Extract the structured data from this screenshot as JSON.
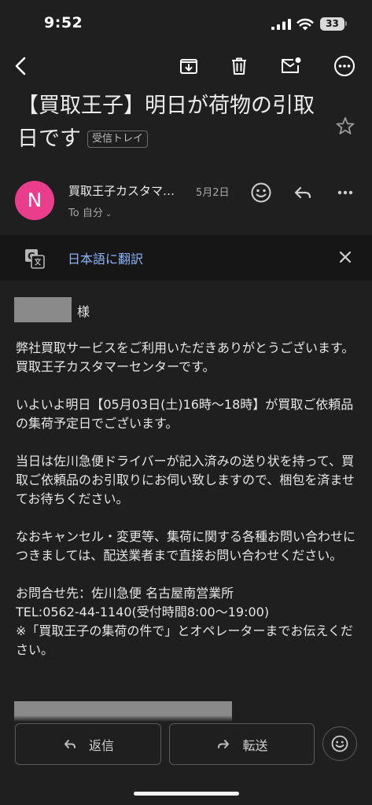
{
  "status_bar": {
    "time": "9:52",
    "battery": "33"
  },
  "email": {
    "subject": "【買取王子】明日が荷物の引取日です",
    "label": "受信トレイ",
    "sender": {
      "avatar_letter": "N",
      "avatar_color": "#ea3d8c",
      "name": "買取王子カスタマ…",
      "date": "5月2日",
      "to": "To 自分"
    },
    "translate": {
      "label": "日本語に翻訳"
    },
    "body": {
      "salutation": "様",
      "p1": "弊社買取サービスをご利用いただきありがとうございます。買取王子カスタマーセンターです。",
      "p2": "いよいよ明日【05月03日(土)16時〜18時】が買取ご依頼品の集荷予定日でございます。",
      "p3": "当日は佐川急便ドライバーが記入済みの送り状を持って、買取ご依頼品のお引取りにお伺い致しますので、梱包を済ませてお待ちください。",
      "p4": "なおキャンセル・変更等、集荷に関する各種お問い合わせにつきましては、配送業者まで直接お問い合わせください。",
      "contact_1": "お問合せ先：佐川急便 名古屋南営業所",
      "contact_2": "TEL:0562-44-1140(受付時間8:00〜19:00)",
      "contact_3": "※「買取王子の集荷の件で」とオペレーターまでお伝えください。"
    }
  },
  "actions": {
    "reply": "返信",
    "forward": "転送"
  },
  "icons": {
    "back": "back-arrow-icon",
    "archive": "archive-icon",
    "trash": "trash-icon",
    "mark_unread": "mark-unread-icon",
    "more": "more-horizontal-icon",
    "star": "star-icon",
    "emoji": "emoji-icon",
    "reply": "reply-icon",
    "forward": "forward-icon",
    "translate": "translate-icon",
    "close": "close-icon"
  },
  "colors": {
    "background": "#1f1f1f",
    "link": "#8ab4f8",
    "avatar": "#ea3d8c"
  }
}
